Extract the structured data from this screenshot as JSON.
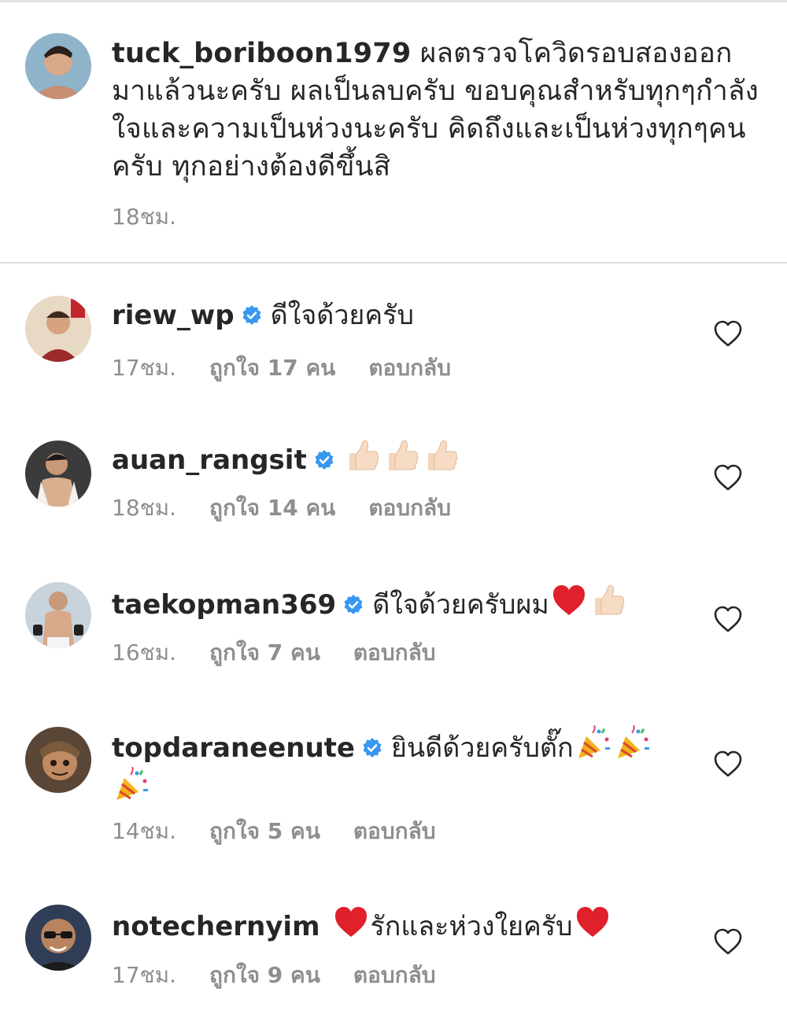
{
  "post": {
    "username": "tuck_boriboon1979",
    "caption": "ผลตรวจโควิดรอบสองออกมาแล้วนะครับ ผลเป็นลบครับ ขอบคุณสำหรับทุกๆกำลังใจและความเป็นห่วงนะครับ คิดถึงและเป็นห่วงทุกๆคนครับ ทุกอย่างต้องดีขึ้นสิ",
    "time": "18ชม."
  },
  "comments": [
    {
      "username": "riew_wp",
      "text": "ดีใจด้วยครับ",
      "text_after": "",
      "time": "17ชม.",
      "likes": "ถูกใจ 17 คน",
      "reply": "ตอบกลับ"
    },
    {
      "username": "auan_rangsit",
      "text": "",
      "text_after": "",
      "time": "18ชม.",
      "likes": "ถูกใจ 14 คน",
      "reply": "ตอบกลับ"
    },
    {
      "username": "taekopman369",
      "text": "ดีใจด้วยครับผม",
      "text_after": "",
      "time": "16ชม.",
      "likes": "ถูกใจ 7 คน",
      "reply": "ตอบกลับ"
    },
    {
      "username": "topdaraneenute",
      "text": "ยินดีด้วยครับตั๊ก",
      "text_after": "",
      "time": "14ชม.",
      "likes": "ถูกใจ 5 คน",
      "reply": "ตอบกลับ"
    },
    {
      "username": "notechernyim",
      "text": "",
      "text_after": "รักและห่วงใยครับ",
      "time": "17ชม.",
      "likes": "ถูกใจ 9 คน",
      "reply": "ตอบกลับ"
    }
  ],
  "colors": {
    "verified": "#3897f0",
    "meta": "#8e8e8e",
    "text": "#262626",
    "heart_emoji": "#e0202a"
  },
  "icons": [
    "verified-badge-icon",
    "heart-outline-icon",
    "thumbs-up-emoji",
    "red-heart-emoji",
    "party-popper-emoji"
  ]
}
